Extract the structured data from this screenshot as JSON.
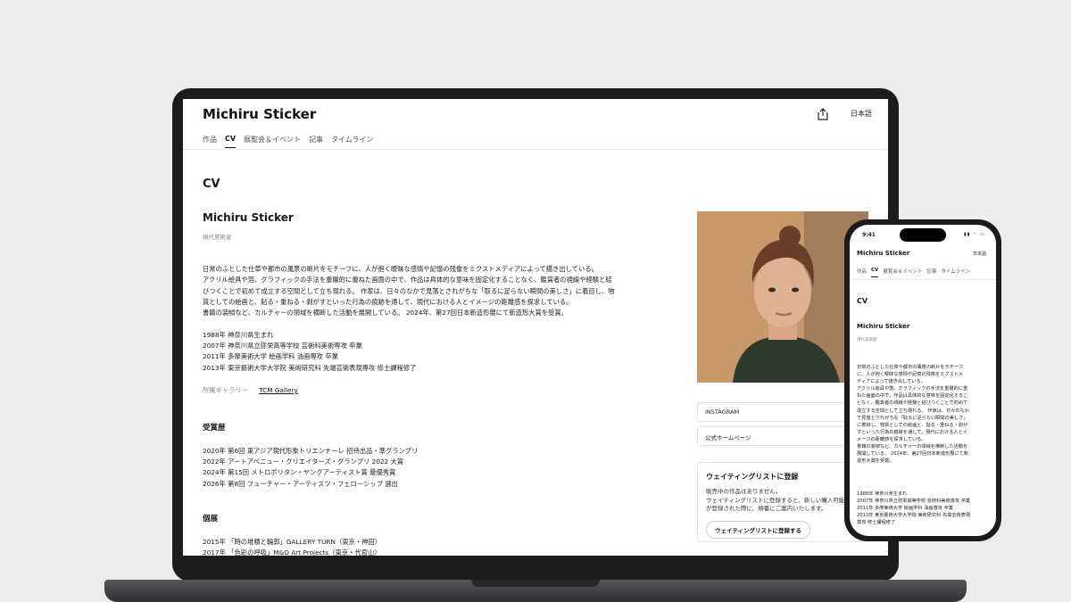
{
  "site": {
    "brand": "Michiru Sticker",
    "language": "日本語",
    "nav": [
      {
        "label": "作品",
        "active": false
      },
      {
        "label": "CV",
        "active": true
      },
      {
        "label": "展覧会＆イベント",
        "active": false
      },
      {
        "label": "記事",
        "active": false
      },
      {
        "label": "タイムライン",
        "active": false
      }
    ]
  },
  "cv": {
    "page_title": "CV",
    "artist_name": "Michiru Sticker",
    "artist_role": "現代美術家",
    "bio_lines": [
      "日常のふとした仕草や都市の風景の断片をモチーフに、人が抱く曖昧な感情や記憶の残像をミクストメディアによって描き出している。",
      "アクリル絵具や箔、グラフィックの手法を重層的に重ねた画面の中で、作品は具体的な意味を固定化することなく、鑑賞者の視線や経験と結",
      "びつくことで初めて成立する空間として立ち現れる。 作家は、日々のなかで見落とされがちな「取るに足らない瞬間の美しさ」に着目し、物",
      "質としての絵画と、貼る・重ねる・剥がすといった行為の痕跡を通して、現代における人とイメージの距離感を探求している。",
      "書籍の装幀など、カルチャーの領域を横断した活動を展開している。 2024年、第27回日本新造形展にて新造形大賞を受賞。"
    ],
    "timeline": [
      "1988年 神奈川県生まれ",
      "2007年 神奈川県立弥栄高等学校 芸術科美術専攻 卒業",
      "2011年 多摩美術大学 絵画学科 油画専攻 卒業",
      "2013年 東京藝術大学大学院 美術研究科 先端芸術表現専攻 修士課程修了"
    ],
    "gallery_label": "所属ギャラリー",
    "gallery_link": "TCM Gallery",
    "awards_title": "受賞歴",
    "awards": [
      "2020年 第6回 東アジア現代形象トリエンナーレ 招待出品・準グランプリ",
      "2022年 アートアベニュー・クリエイターズ・グランプリ 2022 大賞",
      "2024年 第15回 メトロポリタン・ヤングアーティスト賞 最優秀賞",
      "2026年 第8回 フューチャー・アーティスツ・フェローシップ 選出"
    ],
    "solo_title": "個展",
    "solo": [
      "2015年 「時の堆積と輪郭」GALLERY TURN（東京・神田）",
      "2017年 「色彩の呼吸」M&O Art Projects（東京・代官山）"
    ]
  },
  "sidebar": {
    "links": [
      "INSTAGRAM",
      "公式ホームページ"
    ],
    "waitlist": {
      "title": "ウェイティングリストに登録",
      "text": [
        "販売中の作品はありません。",
        "ウェイティングリストに登録すると、新しい購入可能",
        "が登録された際に、順番にご案内いたします。"
      ],
      "button": "ウェイティングリストに登録する"
    }
  },
  "phone": {
    "time": "9:41",
    "bio_lines": [
      "日常のふとした仕草や都市の風景の断片をモチーフ",
      "に、人が抱く曖昧な感情や記憶の残像をミクストメ",
      "ディアによって描き出している。",
      "アクリル絵具や箔、グラフィックの手法を重層的に重",
      "ねた画面の中で、作品は具体的な意味を固定化するこ",
      "となく、鑑賞者の視線や経験と結びつくことで初めて",
      "成立する空間として立ち現れる。 作家は、日々のなか",
      "で見落とされがちな「取るに足らない瞬間の美しさ」",
      "に着目し、物質としての絵画と、貼る・重ねる・剥が",
      "すといった行為の痕跡を通して、現代における人とイ",
      "メージの距離感を探求している。",
      "書籍の装幀など、カルチャーの領域を横断した活動を",
      "展開している。 2024年、第27回日本新造形展にて新",
      "造形大賞を受賞。"
    ],
    "timeline": [
      "1988年 神奈川県生まれ",
      "2007年 神奈川県立弥栄高等学校 芸術科美術専攻 卒業",
      "2011年 多摩美術大学 絵画学科 油画専攻 卒業",
      "2013年 東京藝術大学大学院 美術研究科 先端芸術表現",
      "専攻 修士課程修了"
    ]
  },
  "colors": {
    "background": "#ececec",
    "device": "#1c1c1e",
    "text": "#1a1a1a",
    "muted": "#888888"
  }
}
